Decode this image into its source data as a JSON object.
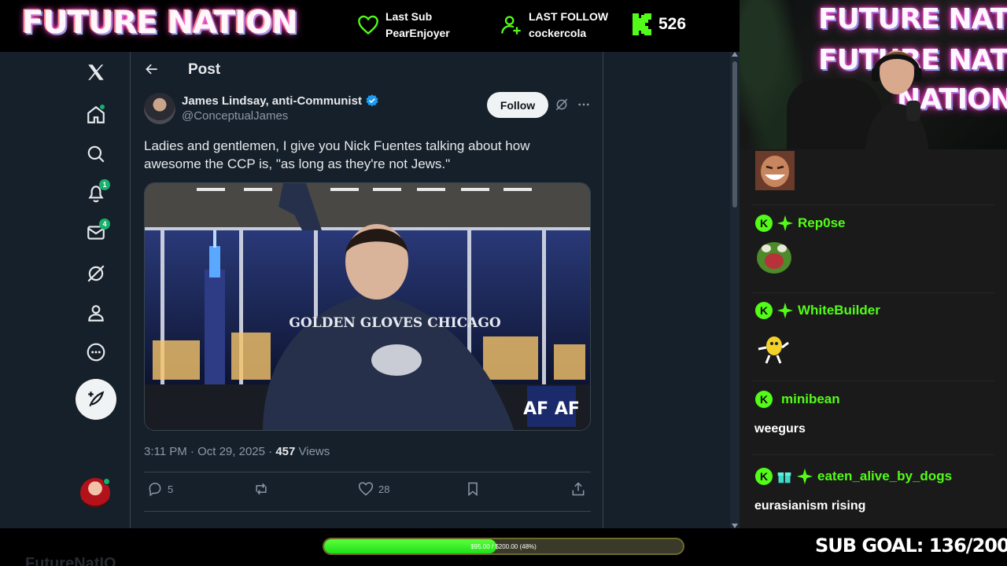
{
  "stream": {
    "brand": "FUTURE NATION",
    "last_sub_label": "Last Sub",
    "last_sub_value": "PearEnjoyer",
    "last_follow_label": "LAST FOLLOW",
    "last_follow_value": "cockercola",
    "kick_count": "526",
    "neon_sign": [
      "FUTURE NATION",
      "FUTURE NATION",
      "NATION"
    ],
    "sub_goal": "SUB GOAL: 136/200",
    "progress_text": "$95.00 / $200.00 (48%)",
    "progress_fraction": 0.48,
    "ghost_text": "FutureNatIO"
  },
  "x": {
    "nav": {
      "notifications_badge": "1",
      "messages_badge": "4"
    },
    "header": {
      "title": "Post"
    },
    "post": {
      "author_name": "James Lindsay, anti-Communist",
      "author_handle": "@ConceptualJames",
      "follow_label": "Follow",
      "text": "Ladies and gentlemen, I give you Nick Fuentes talking about how awesome the CCP is, \"as long as they're not Jews.\"",
      "time": "3:11 PM · Oct 29, 2025 · ",
      "views_count": "457",
      "views_label": " Views",
      "replies": "5",
      "reposts": "",
      "likes": "28",
      "video_logo": "AF AF",
      "hoodie_text": "GOLDEN GLOVES CHICAGO"
    }
  },
  "chat": {
    "messages": [
      {
        "user": "",
        "text": "",
        "emote": "laughing-face-emote"
      },
      {
        "user": "Rep0se",
        "text": "",
        "emote": "pepe-scream-emote"
      },
      {
        "user": "WhiteBuilder",
        "text": "",
        "emote": "dancing-candy-emote"
      },
      {
        "user": "minibean",
        "text": "weegurs"
      },
      {
        "user": "eaten_alive_by_dogs",
        "text": "eurasianism rising"
      }
    ]
  },
  "colors": {
    "x_bg": "#15202b",
    "kick_green": "#53fc18",
    "accent_blue": "#1d9bf0",
    "chat_bg": "#1a1a1a"
  }
}
